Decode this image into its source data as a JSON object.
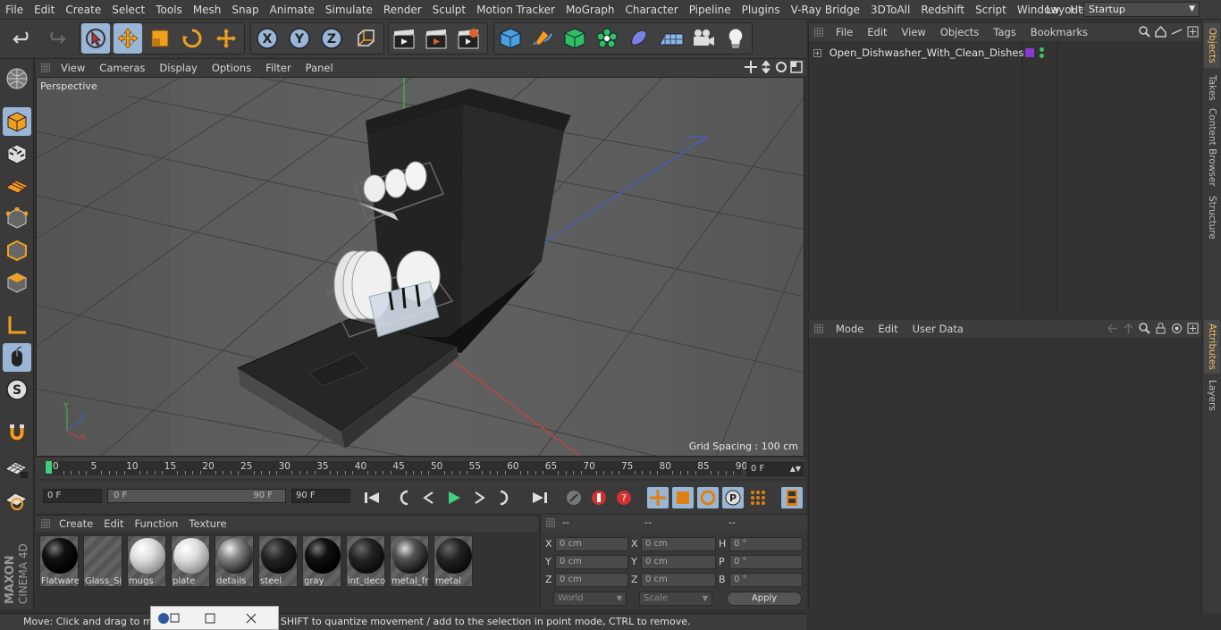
{
  "menu": [
    "File",
    "Edit",
    "Create",
    "Select",
    "Tools",
    "Mesh",
    "Snap",
    "Animate",
    "Simulate",
    "Render",
    "Sculpt",
    "Motion Tracker",
    "MoGraph",
    "Character",
    "Pipeline",
    "Plugins",
    "V-Ray Bridge",
    "3DToAll",
    "Redshift",
    "Script",
    "Window",
    "Help"
  ],
  "layout": {
    "label": "Layout:",
    "value": "Startup"
  },
  "viewport": {
    "menu": [
      "View",
      "Cameras",
      "Display",
      "Options",
      "Filter",
      "Panel"
    ],
    "label": "Perspective",
    "grid_spacing": "Grid Spacing : 100 cm",
    "axis_x": "X",
    "axis_y": "Y",
    "axis_z": "Z"
  },
  "timeline": {
    "ticks": [
      "0",
      "5",
      "10",
      "15",
      "20",
      "25",
      "30",
      "35",
      "40",
      "45",
      "50",
      "55",
      "60",
      "65",
      "70",
      "75",
      "80",
      "85",
      "90"
    ],
    "current_frame": "0 F"
  },
  "playback": {
    "start": "0 F",
    "range_start": "0 F",
    "range_end": "90 F",
    "end": "90 F"
  },
  "materials": {
    "menu": [
      "Create",
      "Edit",
      "Function",
      "Texture"
    ],
    "items": [
      {
        "name": "Flatware",
        "style": "black"
      },
      {
        "name": "Glass_Si",
        "style": "glass"
      },
      {
        "name": "mugs",
        "style": "white"
      },
      {
        "name": "plate",
        "style": "white"
      },
      {
        "name": "details",
        "style": "details"
      },
      {
        "name": "steel",
        "style": "dark"
      },
      {
        "name": "gray",
        "style": "black"
      },
      {
        "name": "int_deco",
        "style": "dark"
      },
      {
        "name": "metal_fr",
        "style": "metal"
      },
      {
        "name": "metal",
        "style": "dark"
      }
    ]
  },
  "coords": {
    "headers": [
      "--",
      "--",
      "--"
    ],
    "rows": [
      {
        "l1": "X",
        "v1": "0 cm",
        "l2": "X",
        "v2": "0 cm",
        "l3": "H",
        "v3": "0 °"
      },
      {
        "l1": "Y",
        "v1": "0 cm",
        "l2": "Y",
        "v2": "0 cm",
        "l3": "P",
        "v3": "0 °"
      },
      {
        "l1": "Z",
        "v1": "0 cm",
        "l2": "Z",
        "v2": "0 cm",
        "l3": "B",
        "v3": "0 °"
      }
    ],
    "world": "World",
    "scale": "Scale",
    "apply": "Apply"
  },
  "objects": {
    "menu": [
      "File",
      "Edit",
      "View",
      "Objects",
      "Tags",
      "Bookmarks"
    ],
    "items": [
      {
        "name": "Open_Dishwasher_With_Clean_Dishes"
      }
    ]
  },
  "attributes": {
    "menu": [
      "Mode",
      "Edit",
      "User Data"
    ]
  },
  "right_tabs": [
    "Objects",
    "Takes",
    "Content Browser",
    "Structure",
    "Attributes",
    "Layers"
  ],
  "status": "Move: Click and drag to move elements. Hold down SHIFT to quantize movement / add to the selection in point mode, CTRL to remove.",
  "brand": {
    "line1": "MAXON",
    "line2": "CINEMA 4D"
  },
  "colors": {
    "accent": "#9ab6d6",
    "timeline_marker": "#3fd07f",
    "axis_x": "#d04040",
    "axis_y": "#40c040",
    "axis_z": "#4060d0"
  }
}
